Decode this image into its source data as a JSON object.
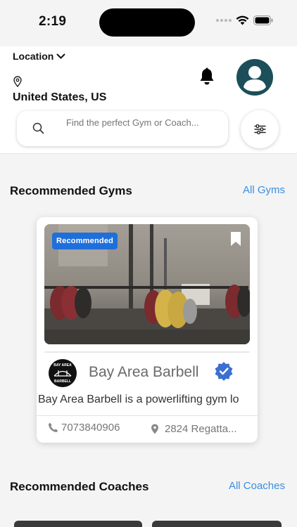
{
  "status_bar": {
    "time": "2:19"
  },
  "header": {
    "location_label": "Location",
    "location_value": "United States, US",
    "search_placeholder": "Find the perfect Gym or Coach..."
  },
  "gyms_section": {
    "title": "Recommended Gyms",
    "link": "All Gyms",
    "card": {
      "badge": "Recommended",
      "logo_text_top": "BAY AREA",
      "logo_text_bottom": "BARBELL",
      "name": "Bay Area Barbell",
      "description": "Bay Area Barbell is a powerlifting gym lo",
      "phone": "7073840906",
      "address": "2824 Regatta..."
    }
  },
  "coaches_section": {
    "title": "Recommended Coaches",
    "link": "All Coaches"
  },
  "colors": {
    "accent": "#3a8ee0",
    "badge": "#1f6fdb",
    "avatar": "#1c4f5a",
    "verified": "#3b6fd1"
  },
  "icons": [
    "chevron-down-icon",
    "map-pin-icon",
    "bell-icon",
    "user-avatar-icon",
    "search-icon",
    "filter-sliders-icon",
    "bookmark-icon",
    "verified-badge-icon",
    "phone-icon",
    "location-icon"
  ]
}
